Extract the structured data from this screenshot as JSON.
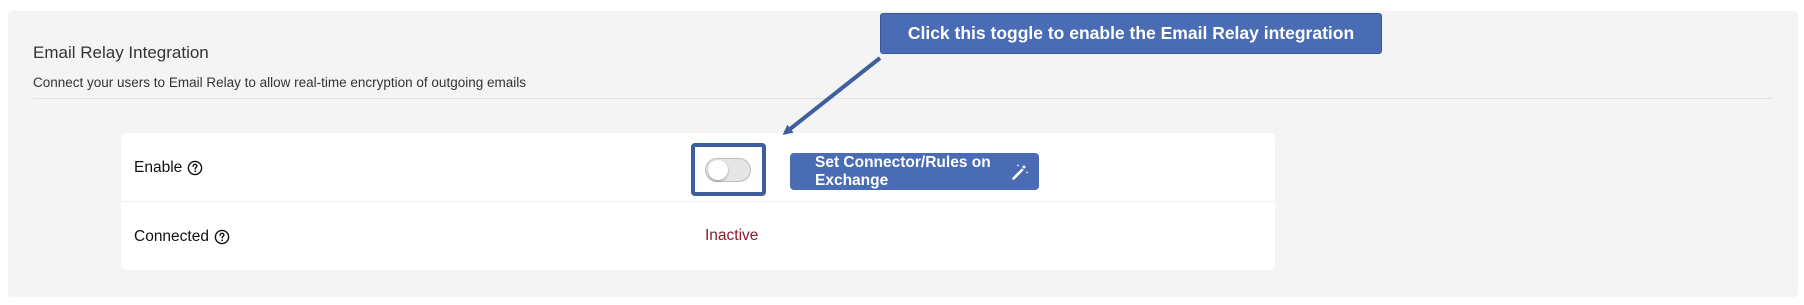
{
  "section": {
    "title": "Email Relay Integration",
    "description": "Connect your users to Email Relay to allow real-time encryption of outgoing emails"
  },
  "rows": {
    "enable": {
      "label": "Enable",
      "toggle_state": "off",
      "button_label": "Set Connector/Rules on Exchange",
      "button_icon": "magic-wand-icon"
    },
    "connected": {
      "label": "Connected",
      "status": "Inactive"
    }
  },
  "callout": {
    "text": "Click this toggle to enable the Email Relay integration"
  },
  "colors": {
    "accent": "#4a6cb4",
    "highlight_border": "#3f5e9e",
    "inactive_status": "#8b1a2b",
    "panel_background": "#f4f4f4"
  },
  "icons": {
    "help": "help-circle-icon"
  }
}
